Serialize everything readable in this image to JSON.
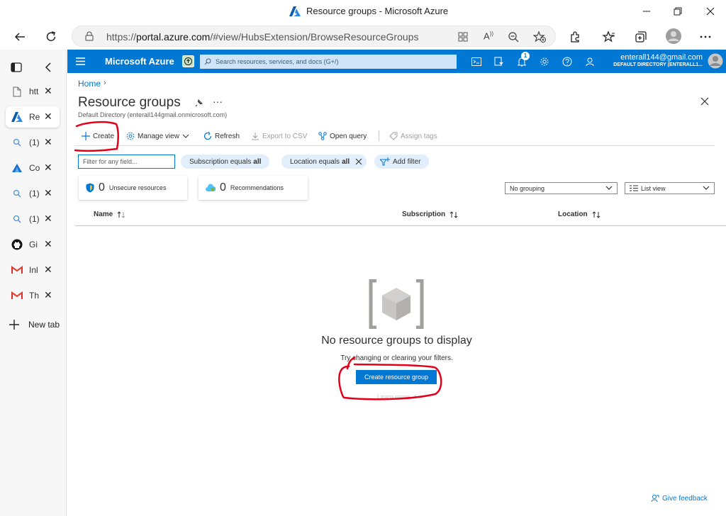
{
  "window": {
    "title": "Resource groups - Microsoft Azure"
  },
  "browser": {
    "url_prefix": "https://",
    "url_host": "portal.azure.com",
    "url_path": "/#view/HubsExtension/BrowseResourceGroups"
  },
  "tabs": [
    {
      "label": "htt",
      "icon": "page-icon",
      "active": false
    },
    {
      "label": "Re",
      "icon": "azure-logo-icon",
      "active": true
    },
    {
      "label": "(1)",
      "icon": "search-icon",
      "active": false
    },
    {
      "label": "Co",
      "icon": "azure-sail-icon",
      "active": false
    },
    {
      "label": "(1)",
      "icon": "search-icon",
      "active": false
    },
    {
      "label": "(1)",
      "icon": "search-icon",
      "active": false
    },
    {
      "label": "Gi",
      "icon": "github-icon",
      "active": false
    },
    {
      "label": "Inl",
      "icon": "gmail-icon",
      "active": false
    },
    {
      "label": "Th",
      "icon": "gmail-icon",
      "active": false
    }
  ],
  "new_tab_label": "New tab",
  "azure": {
    "brand": "Microsoft Azure",
    "search_placeholder": "Search resources, services, and docs (G+/)",
    "notification_count": "1",
    "account_email": "enterall144@gmail.com",
    "account_directory": "DEFAULT DIRECTORY (ENTERALL1..."
  },
  "page": {
    "breadcrumb": "Home",
    "title": "Resource groups",
    "subtitle": "Default Directory (enterall144gmail.onmicrosoft.com)"
  },
  "commands": {
    "create": "Create",
    "manage_view": "Manage view",
    "refresh": "Refresh",
    "export_csv": "Export to CSV",
    "open_query": "Open query",
    "assign_tags": "Assign tags"
  },
  "filters": {
    "placeholder": "Filter for any field...",
    "subscription_label": "Subscription equals",
    "subscription_value": "all",
    "location_label": "Location equals",
    "location_value": "all",
    "add_filter": "Add filter"
  },
  "cards": {
    "unsecure_count": "0",
    "unsecure_label": "Unsecure resources",
    "recommend_count": "0",
    "recommend_label": "Recommendations"
  },
  "view": {
    "grouping": "No grouping",
    "list_view": "List view"
  },
  "columns": {
    "name": "Name",
    "subscription": "Subscription",
    "location": "Location"
  },
  "empty": {
    "title": "No resource groups to display",
    "subtitle": "Try changing or clearing your filters.",
    "cta": "Create resource group",
    "learn_more": "Learn more"
  },
  "feedback": "Give feedback",
  "colors": {
    "azure_blue": "#0078d4",
    "annotation_red": "#e3001b"
  }
}
